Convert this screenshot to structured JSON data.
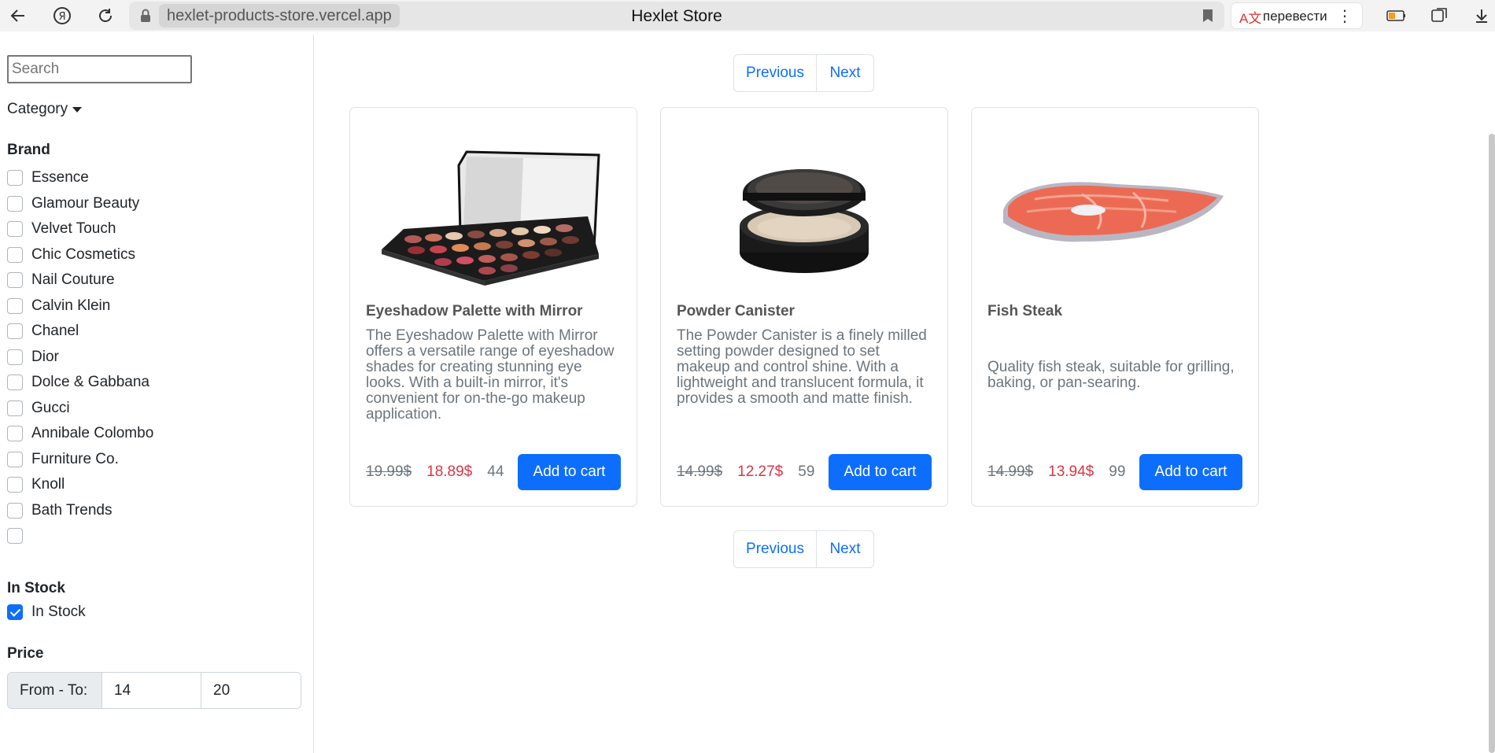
{
  "browser": {
    "url": "hexlet-products-store.vercel.app",
    "tab_title": "Hexlet Store",
    "translate_label": "перевести"
  },
  "sidebar": {
    "search_placeholder": "Search",
    "category_label": "Category",
    "brand_title": "Brand",
    "brands": [
      "Essence",
      "Glamour Beauty",
      "Velvet Touch",
      "Chic Cosmetics",
      "Nail Couture",
      "Calvin Klein",
      "Chanel",
      "Dior",
      "Dolce & Gabbana",
      "Gucci",
      "Annibale Colombo",
      "Furniture Co.",
      "Knoll",
      "Bath Trends",
      ""
    ],
    "instock_title": "In Stock",
    "instock_label": "In Stock",
    "instock_checked": true,
    "price_title": "Price",
    "price_addon": "From - To:",
    "price_from": "14",
    "price_to": "20"
  },
  "pagination": {
    "previous": "Previous",
    "next": "Next"
  },
  "products": [
    {
      "title": "Eyeshadow Palette with Mirror",
      "description": "The Eyeshadow Palette with Mirror offers a versatile range of eyeshadow shades for creating stunning eye looks. With a built-in mirror, it's convenient for on-the-go makeup application.",
      "old_price": "19.99$",
      "new_price": "18.89$",
      "stock": "44",
      "button": "Add to cart",
      "image": "eyeshadow-palette-image"
    },
    {
      "title": "Powder Canister",
      "description": "The Powder Canister is a finely milled setting powder designed to set makeup and control shine. With a lightweight and translucent formula, it provides a smooth and matte finish.",
      "old_price": "14.99$",
      "new_price": "12.27$",
      "stock": "59",
      "button": "Add to cart",
      "image": "powder-canister-image"
    },
    {
      "title": "Fish Steak",
      "description": "Quality fish steak, suitable for grilling, baking, or pan-searing.",
      "old_price": "14.99$",
      "new_price": "13.94$",
      "stock": "99",
      "button": "Add to cart",
      "image": "fish-steak-image"
    }
  ],
  "colors": {
    "primary": "#0d6efd",
    "discount": "#dc3545",
    "muted": "#6c757d"
  }
}
